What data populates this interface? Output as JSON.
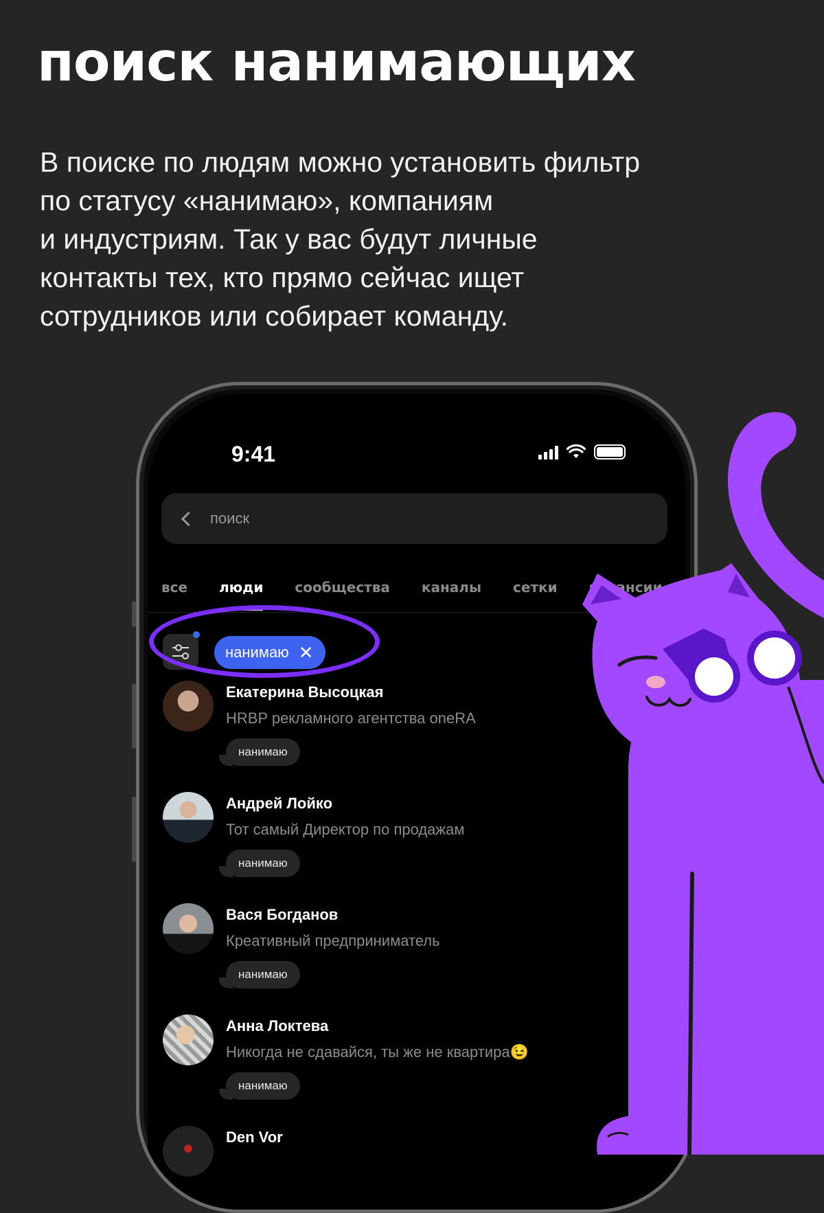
{
  "headline": "поиск нанимающих",
  "body_lines": [
    "В поиске по людям можно установить фильтр",
    "по статусу «нанимаю», компаниям",
    "и индустриям. Так у вас будут личные",
    "контакты тех, кто прямо сейчас ищет",
    "сотрудников или собирает команду."
  ],
  "phone": {
    "status_time": "9:41",
    "search_placeholder": "поиск",
    "tabs": [
      "все",
      "люди",
      "сообщества",
      "каналы",
      "сетки",
      "вакансии"
    ],
    "active_tab": "люди",
    "filter_chip": "нанимаю",
    "people": [
      {
        "name": "Екатерина Высоцкая",
        "description": "HRBP рекламного агентства oneRA",
        "badge": "нанимаю"
      },
      {
        "name": "Андрей Лойко",
        "description": "Тот самый Директор по продажам",
        "badge": "нанимаю"
      },
      {
        "name": "Вася Богданов",
        "description": "Креативный предприниматель",
        "badge": "нанимаю"
      },
      {
        "name": "Анна Локтева",
        "description": "Никогда не сдавайся, ты же не квартира😉",
        "badge": "нанимаю"
      },
      {
        "name": "Den Vor",
        "description": "",
        "badge": ""
      }
    ]
  },
  "colors": {
    "background": "#252525",
    "accent_purple": "#a249ff",
    "ring_purple": "#7b2fff",
    "chip_blue": "#3d63f0"
  }
}
